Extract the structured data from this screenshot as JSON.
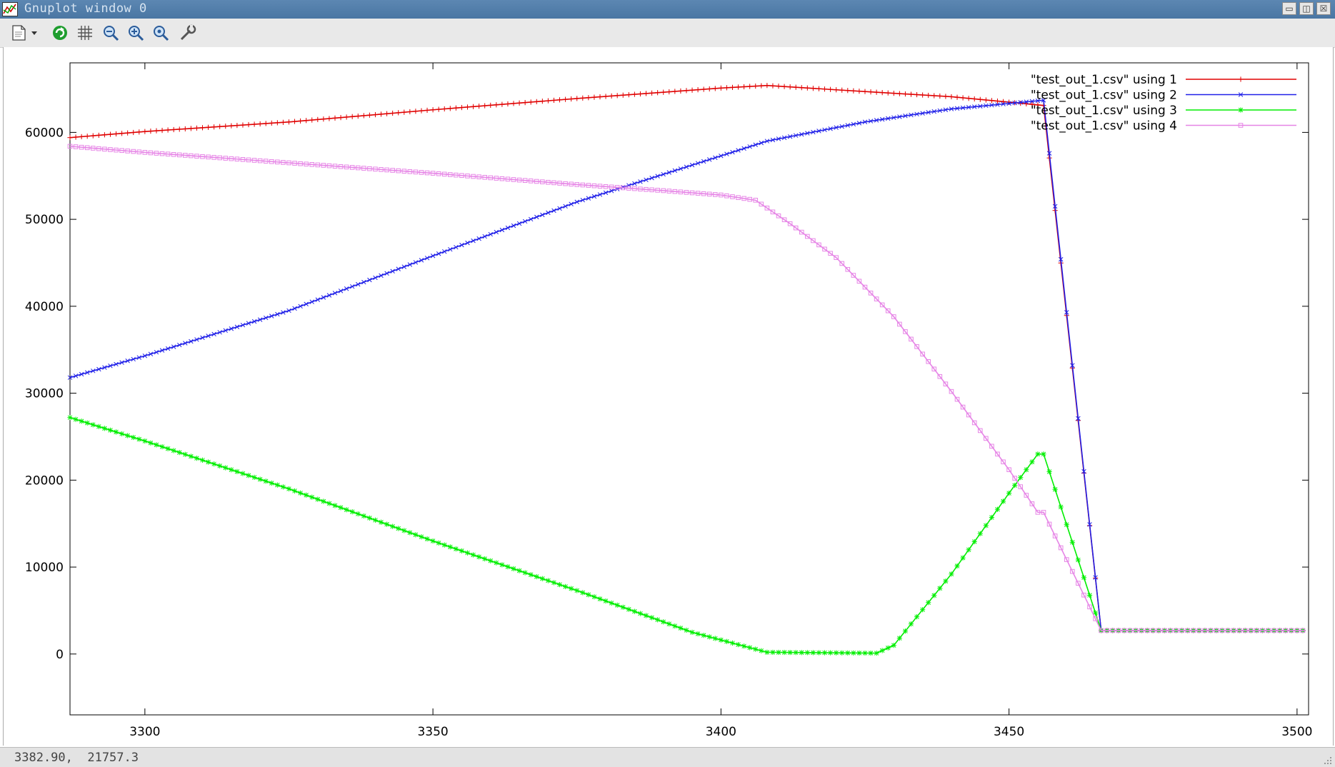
{
  "window": {
    "title": "Gnuplot window 0",
    "buttons": [
      "minimize-icon",
      "maximize-icon",
      "close-icon"
    ]
  },
  "toolbar": {
    "items": [
      "copy-icon",
      "dropdown-arrow-icon",
      "replot-icon",
      "grid-icon",
      "zoom-out-icon",
      "zoom-in-icon",
      "zoom-unzoom-icon",
      "settings-icon"
    ]
  },
  "status": {
    "coords": "3382.90,  21757.3"
  },
  "colors": {
    "series1": "#e00000",
    "series2": "#2020e8",
    "series3": "#00ee00",
    "series4": "#e685e6"
  },
  "chart_data": {
    "type": "line",
    "title": "",
    "xlabel": "",
    "ylabel": "",
    "xlim": [
      3287,
      3502
    ],
    "ylim": [
      -7000,
      68000
    ],
    "xticks": [
      3300,
      3350,
      3400,
      3450,
      3500
    ],
    "yticks": [
      0,
      10000,
      20000,
      30000,
      40000,
      50000,
      60000
    ],
    "legend_position": "top-right",
    "grid": false,
    "series": [
      {
        "name": "\"test_out_1.csv\" using 1",
        "marker": "plus",
        "color": "#e00000",
        "points": [
          [
            3287,
            59400
          ],
          [
            3300,
            60100
          ],
          [
            3325,
            61200
          ],
          [
            3350,
            62600
          ],
          [
            3375,
            63900
          ],
          [
            3400,
            65100
          ],
          [
            3408,
            65400
          ],
          [
            3420,
            64900
          ],
          [
            3440,
            64100
          ],
          [
            3456,
            63100
          ],
          [
            3466,
            2700
          ],
          [
            3502,
            2700
          ]
        ]
      },
      {
        "name": "\"test_out_1.csv\" using 2",
        "marker": "cross",
        "color": "#2020e8",
        "points": [
          [
            3287,
            31800
          ],
          [
            3300,
            34300
          ],
          [
            3325,
            39500
          ],
          [
            3350,
            45800
          ],
          [
            3375,
            52000
          ],
          [
            3400,
            57300
          ],
          [
            3408,
            59000
          ],
          [
            3425,
            61200
          ],
          [
            3440,
            62700
          ],
          [
            3456,
            63700
          ],
          [
            3466,
            2700
          ],
          [
            3502,
            2700
          ]
        ]
      },
      {
        "name": "\"test_out_1.csv\" using 3",
        "marker": "star",
        "color": "#00ee00",
        "points": [
          [
            3287,
            27200
          ],
          [
            3300,
            24500
          ],
          [
            3325,
            19000
          ],
          [
            3350,
            13000
          ],
          [
            3375,
            7300
          ],
          [
            3395,
            2500
          ],
          [
            3408,
            200
          ],
          [
            3427,
            100
          ],
          [
            3430,
            1000
          ],
          [
            3440,
            9200
          ],
          [
            3450,
            18500
          ],
          [
            3455,
            23000
          ],
          [
            3456,
            23000
          ],
          [
            3466,
            2700
          ],
          [
            3502,
            2700
          ]
        ]
      },
      {
        "name": "\"test_out_1.csv\" using 4",
        "marker": "box",
        "color": "#e685e6",
        "points": [
          [
            3287,
            58400
          ],
          [
            3300,
            57700
          ],
          [
            3325,
            56500
          ],
          [
            3350,
            55300
          ],
          [
            3375,
            54000
          ],
          [
            3390,
            53300
          ],
          [
            3400,
            52800
          ],
          [
            3406,
            52200
          ],
          [
            3412,
            49500
          ],
          [
            3420,
            45600
          ],
          [
            3430,
            38800
          ],
          [
            3440,
            30200
          ],
          [
            3450,
            21200
          ],
          [
            3455,
            16300
          ],
          [
            3456,
            16300
          ],
          [
            3466,
            2700
          ],
          [
            3502,
            2700
          ]
        ]
      }
    ]
  }
}
